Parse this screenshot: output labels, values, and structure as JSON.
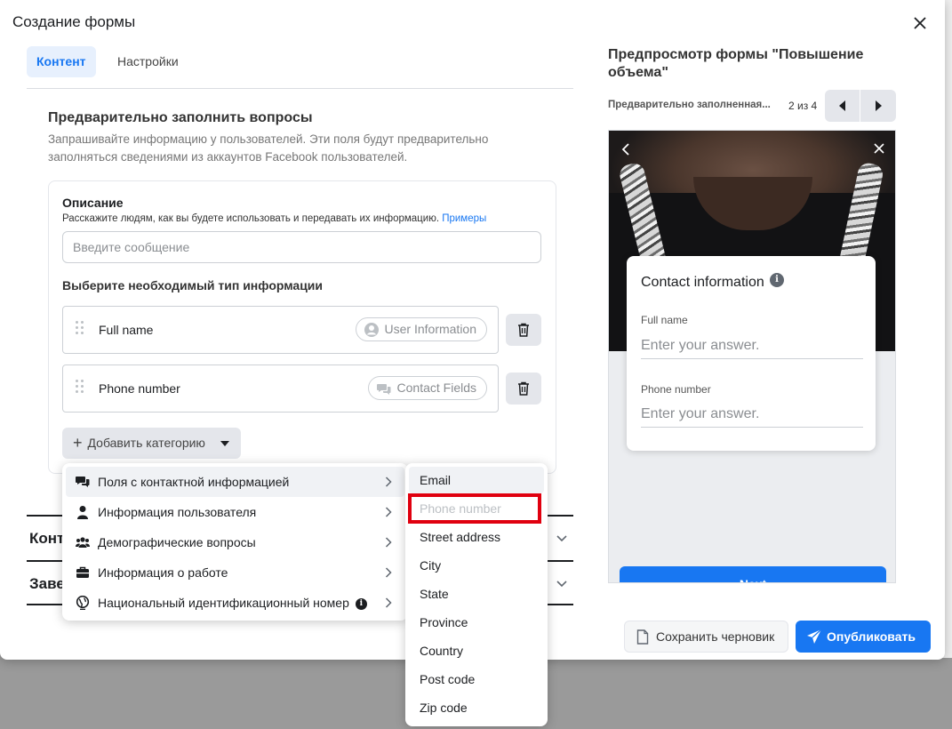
{
  "dialog": {
    "title": "Создание формы",
    "tabs": [
      {
        "label": "Контент",
        "active": true
      },
      {
        "label": "Настройки",
        "active": false
      }
    ]
  },
  "prefill": {
    "title": "Предварительно заполнить вопросы",
    "description": "Запрашивайте информацию у пользователей. Эти поля будут предварительно заполняться сведениями из аккаунтов Facebook пользователей.",
    "desc_label": "Описание",
    "desc_help": "Расскажите людям, как вы будете использовать и передавать их информацию.",
    "desc_link": "Примеры",
    "message_placeholder": "Введите сообщение",
    "type_label": "Выберите необходимый тип информации",
    "fields": [
      {
        "name": "Full name",
        "category": "User Information",
        "icon": "user-icon"
      },
      {
        "name": "Phone number",
        "category": "Contact Fields",
        "icon": "chat-icon"
      }
    ],
    "add_category": "Добавить категорию"
  },
  "collapsed_sections": [
    "Конте",
    "Заве"
  ],
  "category_menu": [
    {
      "label": "Поля с контактной информацией",
      "icon": "chat-icon",
      "highlighted": true
    },
    {
      "label": "Информация пользователя",
      "icon": "user-icon"
    },
    {
      "label": "Демографические вопросы",
      "icon": "people-icon"
    },
    {
      "label": "Информация о работе",
      "icon": "briefcase-icon"
    },
    {
      "label": "Национальный идентификационный номер",
      "icon": "globe-icon",
      "info": "i"
    }
  ],
  "contact_submenu": [
    {
      "label": "Email",
      "highlighted": true
    },
    {
      "label": "Phone number",
      "disabled": true
    },
    {
      "label": "Street address"
    },
    {
      "label": "City"
    },
    {
      "label": "State"
    },
    {
      "label": "Province"
    },
    {
      "label": "Country"
    },
    {
      "label": "Post code"
    },
    {
      "label": "Zip code"
    }
  ],
  "preview": {
    "title": "Предпросмотр формы \"Повышение объема\"",
    "subtitle": "Предварительно заполненная...",
    "counter": "2 из 4",
    "card_title": "Contact information",
    "card_info": "i",
    "fields": [
      {
        "label": "Full name",
        "placeholder": "Enter your answer."
      },
      {
        "label": "Phone number",
        "placeholder": "Enter your answer."
      }
    ],
    "next_label": "Next"
  },
  "footer": {
    "draft": "Сохранить черновик",
    "publish": "Опубликовать"
  },
  "colors": {
    "accent": "#1877f2",
    "highlight_box": "#e0000f"
  }
}
